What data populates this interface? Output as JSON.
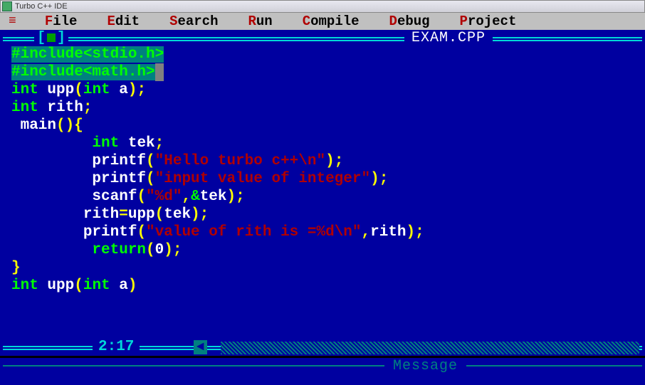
{
  "window": {
    "title": "Turbo C++ IDE"
  },
  "menu": {
    "file": "File",
    "file_hk": "F",
    "edit": "Edit",
    "edit_hk": "E",
    "search": "Search",
    "search_hk": "S",
    "run": "Run",
    "run_hk": "R",
    "compile": "Compile",
    "compile_hk": "C",
    "debug": "Debug",
    "debug_hk": "D",
    "project": "Project",
    "project_hk": "P"
  },
  "editor": {
    "filename": "EXAM.CPP",
    "cursor_pos": "2:17",
    "code": {
      "l1": "#include<stdio.h>",
      "l2": "#include<math.h>",
      "l3_a": "int",
      "l3_b": " upp",
      "l3_c": "(",
      "l3_d": "int",
      "l3_e": " a",
      "l3_f": ");",
      "l4_a": "int",
      "l4_b": " rith",
      "l4_c": ";",
      "l5_a": " main",
      "l5_b": "(){",
      "l6_a": "         int",
      "l6_b": " tek",
      "l6_c": ";",
      "l7_a": "         printf",
      "l7_b": "(",
      "l7_c": "\"Hello turbo c++\\n\"",
      "l7_d": ");",
      "l8_a": "         printf",
      "l8_b": "(",
      "l8_c": "\"input value of integer\"",
      "l8_d": ");",
      "l9_a": "         scanf",
      "l9_b": "(",
      "l9_c": "\"%d\"",
      "l9_d": ",",
      "l9_e": "&",
      "l9_f": "tek",
      "l9_g": ");",
      "l10_a": "        rith",
      "l10_b": "=",
      "l10_c": "upp",
      "l10_d": "(",
      "l10_e": "tek",
      "l10_f": ");",
      "l11_a": "        printf",
      "l11_b": "(",
      "l11_c": "\"value of rith is =%d\\n\"",
      "l11_d": ",",
      "l11_e": "rith",
      "l11_f": ");",
      "l12_a": "         return",
      "l12_b": "(",
      "l12_c": "0",
      "l12_d": ");",
      "l13": "}",
      "l14_a": "int",
      "l14_b": " upp",
      "l14_c": "(",
      "l14_d": "int",
      "l14_e": " a",
      "l14_f": ")"
    }
  },
  "message": {
    "title": "Message"
  }
}
